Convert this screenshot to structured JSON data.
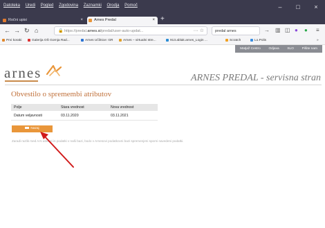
{
  "browser": {
    "menu": [
      "Datoteka",
      "Uredi",
      "Pogled",
      "Zgodovina",
      "Zaznamki",
      "Orodja",
      "Pomoč"
    ],
    "window_controls": {
      "minimize": "–",
      "maximize": "□",
      "close": "×"
    },
    "tabs": [
      {
        "label": "Ročni upisi",
        "active": false
      },
      {
        "label": "Arnes Predal",
        "active": true
      }
    ],
    "new_tab": "+",
    "url": {
      "prefix": "https://predal.",
      "domain": "arnes.si",
      "path": "/predal/user-auto-updat..."
    },
    "search_text": "predal arnes",
    "bookmarks": [
      "Prvi koraki",
      "Galerija OŠ Gornja Rad...",
      "Arnes Učilnice: GR",
      "Arnes – virtualni stre...",
      "913.ablak.arnes_Login ...",
      "Scratch",
      "Lo.Polis"
    ],
    "colors": {
      "chrome": "#3b3a4d",
      "toolbar": "#f5f5f7"
    }
  },
  "site": {
    "nav": [
      "Matjaž Cestro",
      "Odjava",
      "SLO",
      "Pišite nam"
    ],
    "logo": {
      "text": "arnes",
      "subtitle_color": "#c98a4a"
    },
    "tagline": "ARNES PREDAL - servisna stran",
    "title": "Obvestilo o spremembi atributov",
    "table": {
      "headers": [
        "Polje",
        "Stara vrednost",
        "Nova vrednost"
      ],
      "rows": [
        [
          "Datum veljavnosti",
          "03.11.2020",
          "03.11.2021"
        ]
      ]
    },
    "back_button": "Nazaj",
    "info": "Zaradi razlik med AAI atributi in podatki v naši bazi, bodo v Arnesovi podatkovni bazi spremenjeni sporni navedeni podatki.",
    "colors": {
      "accent": "#e9963a",
      "title": "#c0703a",
      "nav_bg": "#8a8c93"
    }
  },
  "annotation": {
    "arrow_color": "#d11a1a"
  }
}
